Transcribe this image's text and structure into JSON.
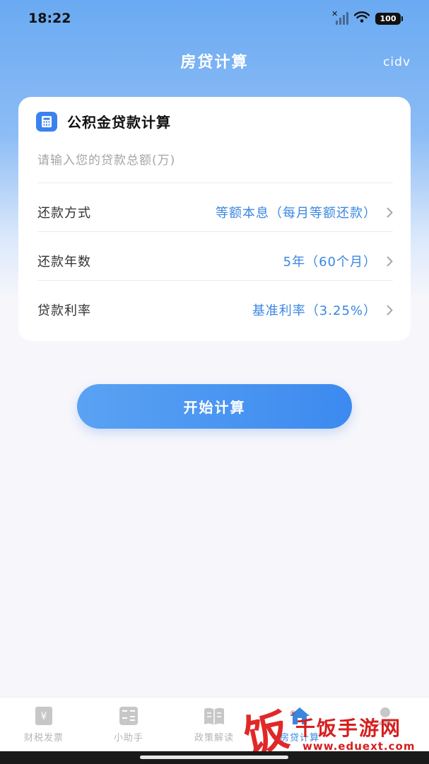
{
  "status_bar": {
    "time": "18:22",
    "battery": "100"
  },
  "nav": {
    "title": "房贷计算",
    "right_label": "cidv"
  },
  "card": {
    "title": "公积金贷款计算",
    "icon": "calculator-icon",
    "amount_placeholder": "请输入您的贷款总额(万)",
    "amount_value": "",
    "rows": [
      {
        "label": "还款方式",
        "value": "等额本息（每月等额还款）"
      },
      {
        "label": "还款年数",
        "value": "5年（60个月）"
      },
      {
        "label": "贷款利率",
        "value": "基准利率（3.25%）"
      }
    ]
  },
  "calc_button": {
    "label": "开始计算"
  },
  "tab_bar": {
    "items": [
      {
        "label": "财税发票",
        "icon": "invoice-icon",
        "active": false
      },
      {
        "label": "小助手",
        "icon": "calculator-grid-icon",
        "active": false
      },
      {
        "label": "政策解读",
        "icon": "book-icon",
        "active": false
      },
      {
        "label": "房贷计算",
        "icon": "house-icon",
        "active": true
      },
      {
        "label": "",
        "icon": "profile-icon",
        "active": false
      }
    ]
  },
  "watermark": {
    "glyph": "饭",
    "title": "千饭手游网",
    "url": "www.eduext.com",
    "registered": "®"
  },
  "colors": {
    "accent": "#3a87e0",
    "button": "#4a94f1",
    "header_gradient_top": "#6aaaf2",
    "watermark_red": "#d61f1f"
  }
}
